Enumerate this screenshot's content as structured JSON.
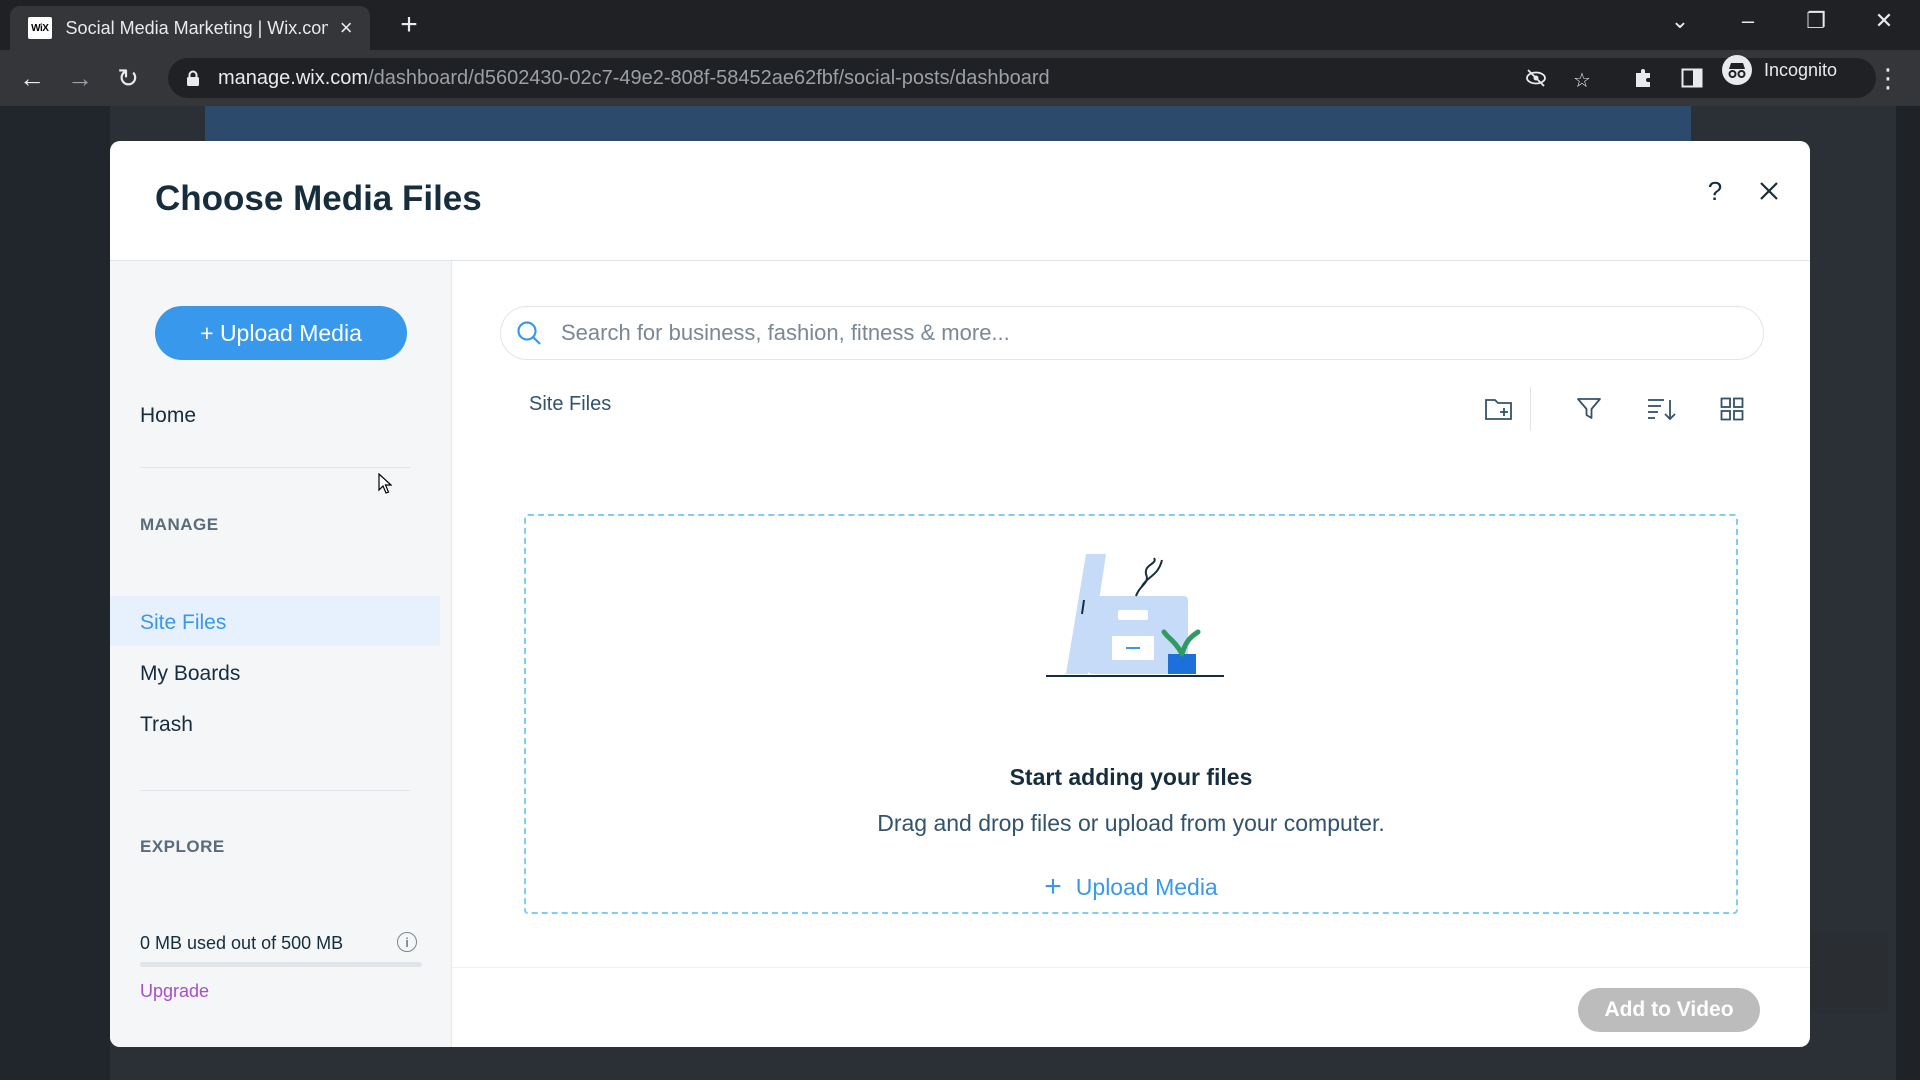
{
  "browser": {
    "tab_title": "Social Media Marketing | Wix.com",
    "tab_favicon": "WiX",
    "url_host": "manage.wix.com",
    "url_path": "/dashboard/d5602430-02c7-49e2-808f-58452ae62fbf/social-posts/dashboard",
    "profile_label": "Incognito"
  },
  "modal": {
    "title": "Choose Media Files",
    "upload_button": "+ Upload Media",
    "sidebar": {
      "home": "Home",
      "manage_heading": "MANAGE",
      "items": [
        "Site Files",
        "My Boards",
        "Trash"
      ],
      "explore_heading": "EXPLORE",
      "storage_text": "0 MB used out of 500 MB",
      "storage_used_fraction": 0,
      "upgrade": "Upgrade"
    },
    "search_placeholder": "Search for business, fashion, fitness & more...",
    "breadcrumb": "Site Files",
    "empty_state": {
      "title": "Start adding your files",
      "subtitle": "Drag and drop files or upload from your computer.",
      "upload_link": "Upload Media"
    },
    "footer_button": "Add to Video"
  },
  "colors": {
    "accent": "#3899ec",
    "upgrade": "#aa4dc8",
    "title": "#162d3d",
    "disabled_button": "#bcbcbc"
  }
}
